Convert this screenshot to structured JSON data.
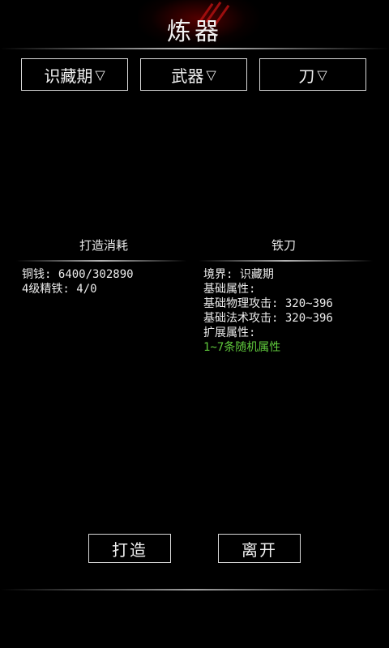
{
  "header": {
    "title": "炼器"
  },
  "filters": [
    {
      "label": "识藏期",
      "arrow": "▽"
    },
    {
      "label": "武器",
      "arrow": "▽"
    },
    {
      "label": "刀",
      "arrow": "▽"
    }
  ],
  "cost": {
    "title": "打造消耗",
    "lines": [
      "铜钱: 6400/302890",
      "4级精铁: 4/0"
    ]
  },
  "item": {
    "title": "铁刀",
    "lines": [
      "境界: 识藏期",
      "基础属性:",
      "基础物理攻击: 320~396",
      "基础法术攻击: 320~396",
      "扩展属性:"
    ],
    "random_attr": "1~7条随机属性"
  },
  "buttons": {
    "forge": "打造",
    "leave": "离开"
  },
  "colors": {
    "background": "#000000",
    "text": "#e8e8e8",
    "accent_green": "#5fc93c",
    "title_glow": "#960000"
  }
}
